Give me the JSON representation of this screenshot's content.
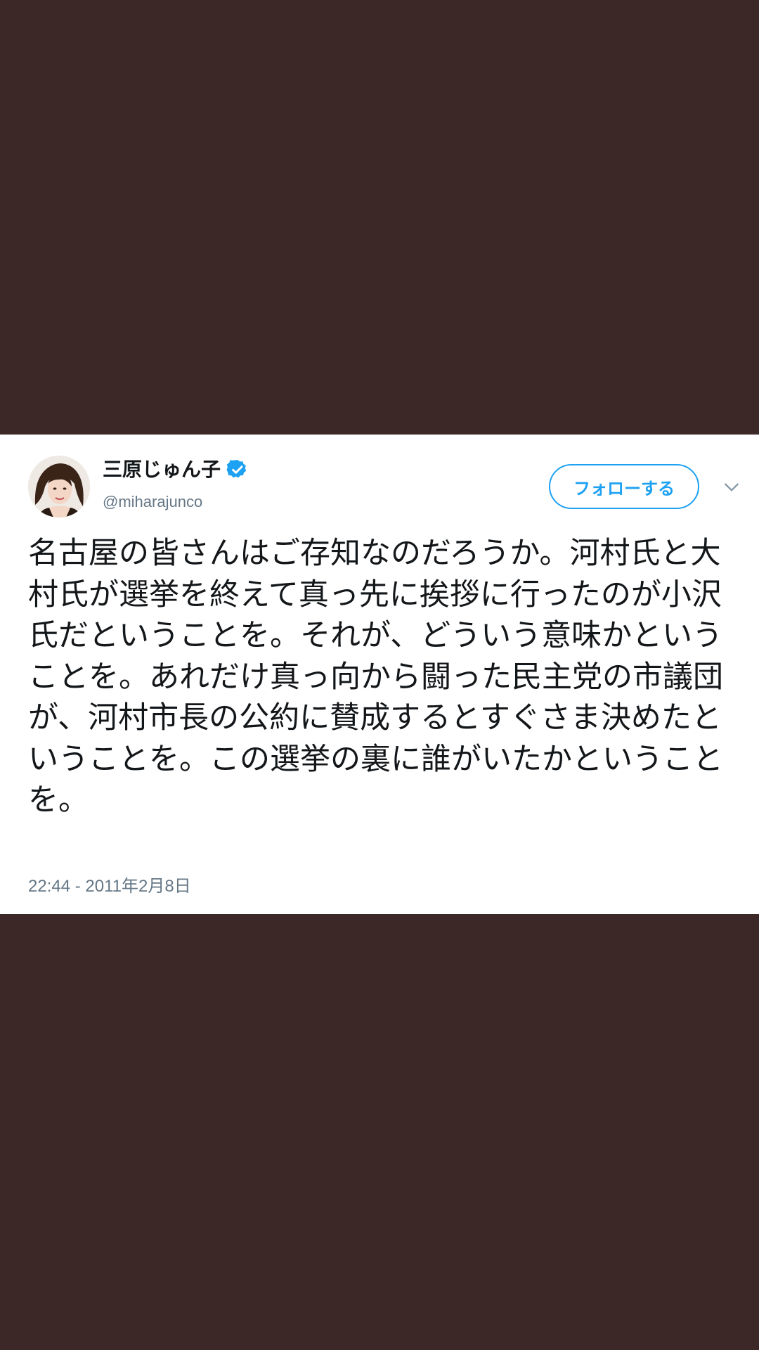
{
  "tweet": {
    "author": {
      "display_name": "三原じゅん子",
      "handle": "@miharajunco",
      "verified_icon": "verified-badge-icon",
      "avatar_icon": "user-avatar"
    },
    "follow_button_label": "フォローする",
    "menu_icon": "chevron-down-icon",
    "text": "名古屋の皆さんはご存知なのだろうか。河村氏と大村氏が選挙を終えて真っ先に挨拶に行ったのが小沢氏だということを。それが、どういう意味かということを。あれだけ真っ向から闘った民主党の市議団が、河村市長の公約に賛成するとすぐさま決めたということを。この選挙の裏に誰がいたかということを。",
    "timestamp": "22:44 - 2011年2月8日"
  },
  "colors": {
    "background": "#3d2828",
    "card": "#ffffff",
    "accent": "#1da1f2",
    "text_primary": "#14171a",
    "text_secondary": "#657786"
  }
}
